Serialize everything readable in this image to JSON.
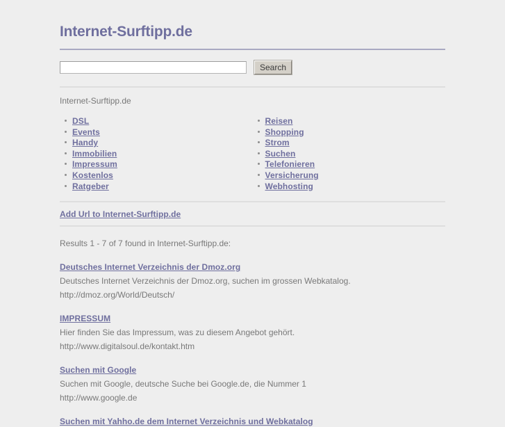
{
  "site": {
    "title": "Internet-Surftipp.de",
    "accent_color": "#6f6f9e",
    "background_color": "#eeeeee",
    "text_color": "#787878"
  },
  "search": {
    "value": "",
    "placeholder": "",
    "button_label": "Search"
  },
  "breadcrumb": {
    "label": "Internet-Surftipp.de"
  },
  "categories": {
    "left": [
      {
        "label": "DSL"
      },
      {
        "label": "Events"
      },
      {
        "label": "Handy"
      },
      {
        "label": "Immobilien"
      },
      {
        "label": "Impressum"
      },
      {
        "label": "Kostenlos"
      },
      {
        "label": "Ratgeber"
      }
    ],
    "right": [
      {
        "label": "Reisen"
      },
      {
        "label": "Shopping"
      },
      {
        "label": "Strom"
      },
      {
        "label": "Suchen"
      },
      {
        "label": "Telefonieren"
      },
      {
        "label": "Versicherung"
      },
      {
        "label": "Webhosting"
      }
    ]
  },
  "add_url": {
    "label": "Add Url to Internet-Surftipp.de"
  },
  "results": {
    "count_text": "Results 1 - 7 of 7 found in Internet-Surftipp.de:",
    "items": [
      {
        "title": "Deutsches Internet Verzeichnis der Dmoz.org",
        "description": "Deutsches Internet Verzeichnis der Dmoz.org, suchen im grossen Webkatalog.",
        "url": "http://dmoz.org/World/Deutsch/"
      },
      {
        "title": "IMPRESSUM",
        "description": "Hier finden Sie das Impressum, was zu diesem Angebot gehört.",
        "url": "http://www.digitalsoul.de/kontakt.htm"
      },
      {
        "title": "Suchen mit Google",
        "description": "Suchen mit Google, deutsche Suche bei Google.de, die Nummer 1",
        "url": "http://www.google.de"
      },
      {
        "title": "Suchen mit Yahho.de dem Internet Verzeichnis und Webkatalog",
        "description": "",
        "url": ""
      }
    ]
  }
}
